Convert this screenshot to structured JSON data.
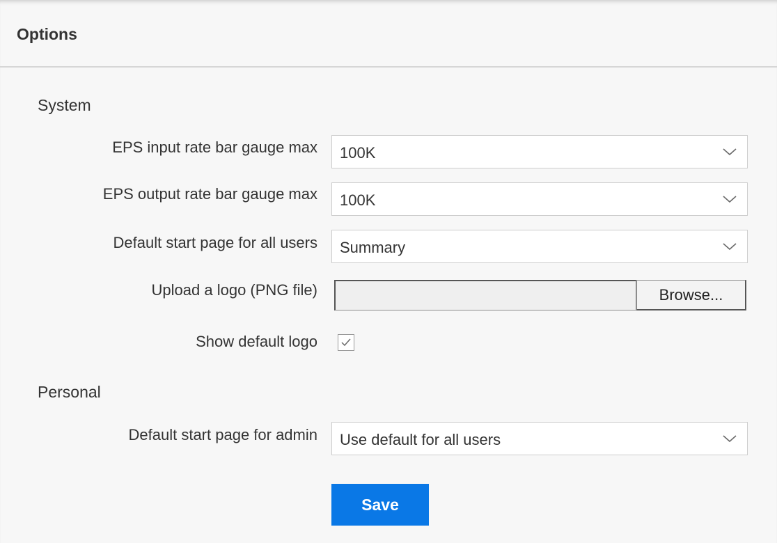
{
  "panel": {
    "title": "Options"
  },
  "system": {
    "section_title": "System",
    "eps_input": {
      "label": "EPS input rate bar gauge max",
      "value": "100K"
    },
    "eps_output": {
      "label": "EPS output rate bar gauge max",
      "value": "100K"
    },
    "default_start_page": {
      "label": "Default start page for all users",
      "value": "Summary"
    },
    "upload_logo": {
      "label": "Upload a logo (PNG file)",
      "value": "",
      "browse_label": "Browse..."
    },
    "show_default_logo": {
      "label": "Show default logo",
      "checked": true
    }
  },
  "personal": {
    "section_title": "Personal",
    "admin_start_page": {
      "label": "Default start page for admin",
      "value": "Use default for all users"
    }
  },
  "actions": {
    "save_label": "Save"
  },
  "colors": {
    "save_button": "#0a78e6",
    "panel_background": "#f7f7f7",
    "divider": "#d6d6d6"
  },
  "icons": {
    "select_arrow": "chevron-down-icon",
    "checkbox_mark": "checkmark-icon"
  }
}
